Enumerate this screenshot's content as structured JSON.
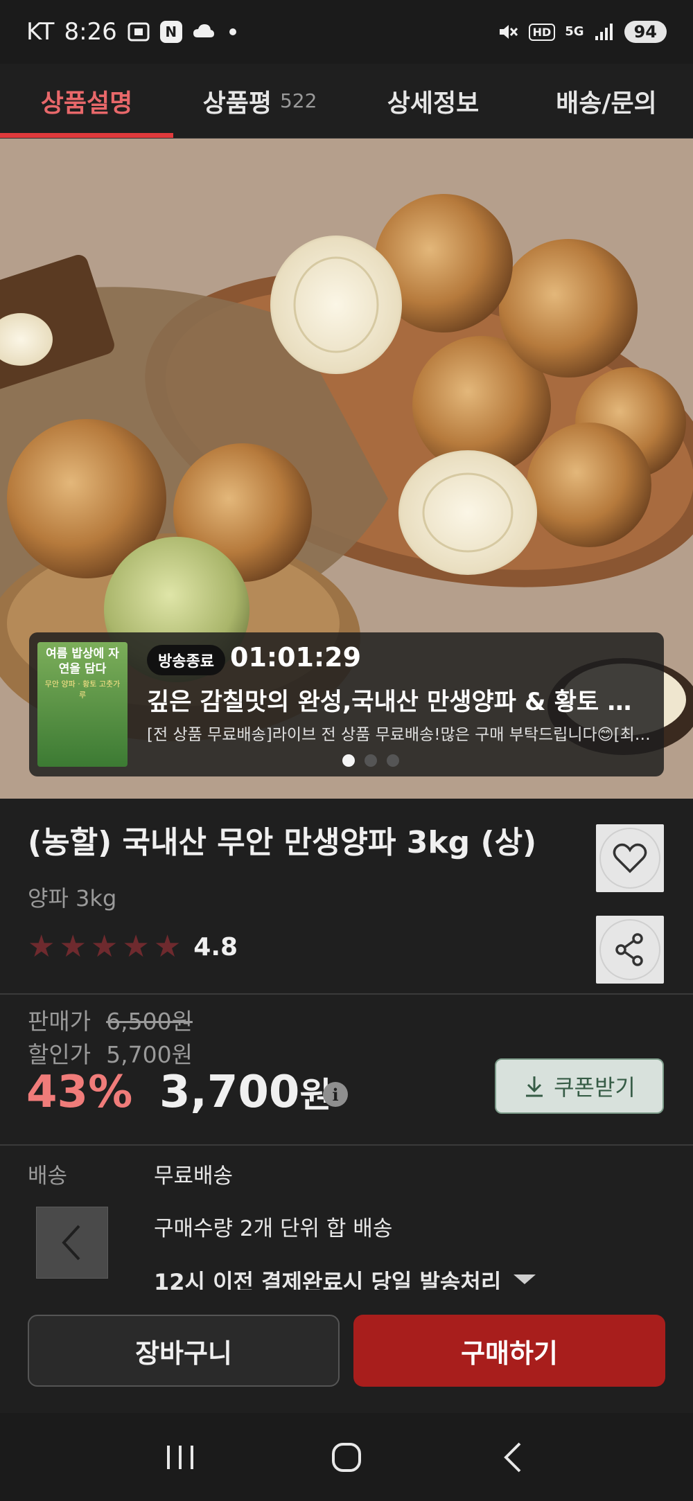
{
  "status_bar": {
    "carrier": "KT",
    "time": "8:26",
    "hd_label": "HD",
    "network_label": "5G",
    "battery": "94"
  },
  "tabs": [
    {
      "label": "상품설명",
      "count": "",
      "active": true
    },
    {
      "label": "상품평",
      "count": "522",
      "active": false
    },
    {
      "label": "상세정보",
      "count": "",
      "active": false
    },
    {
      "label": "배송/문의",
      "count": "",
      "active": false
    }
  ],
  "live_banner": {
    "thumbnail_text_1": "여름 밥상에 자연을 담다",
    "thumbnail_text_2": "무안 양파 · 황토 고춧가루",
    "status_badge": "방송종료",
    "timer": "01:01:29",
    "title": "깊은 감칠맛의 완성,국내산 만생양파 & 황토 고춧가루",
    "subtitle": "[전 상품 무료배송]라이브 전 상품 무료배송!많은 구매 부탁드립니다😊[최대 혜택]",
    "page_count": 3,
    "active_page": 0
  },
  "product": {
    "title": "(농할) 국내산 무안 만생양파 3kg (상)",
    "subtitle": "양파 3kg",
    "rating": "4.8",
    "stars": 5
  },
  "pricing": {
    "sale_label": "판매가",
    "sale_price": "6,500원",
    "discount_label": "할인가",
    "discount_price": "5,700원",
    "discount_rate": "43%",
    "final_price": "3,700",
    "currency": "원",
    "coupon_label": "쿠폰받기"
  },
  "shipping": {
    "label": "배송",
    "free": "무료배송",
    "bundle": "구매수량 2개 단위 합 배송",
    "same_day": "12시 이전 결제완료시 당일 발송처리"
  },
  "actions": {
    "cart": "장바구니",
    "buy": "구매하기"
  },
  "colors": {
    "accent": "#e03a3c",
    "buy_button": "#a81e1c",
    "discount": "#f07c7a",
    "star": "#6e2a2e"
  }
}
